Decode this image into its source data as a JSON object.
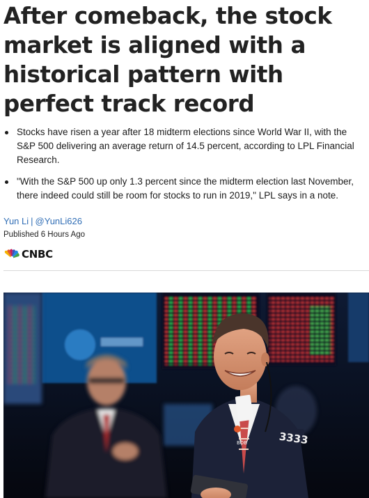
{
  "headline": "After comeback, the stock market is aligned with a historical pattern with perfect track record",
  "bullets": [
    "Stocks have risen a year after 18 midterm elections since World War II, with the S&P 500 delivering an average return of 14.5 percent, according to LPL Financial Research.",
    "\"With the S&P 500 up only 1.3 percent since the midterm election last November, there indeed could still be room for stocks to run in 2019,\" LPL says in a note."
  ],
  "byline": {
    "author": "Yun Li",
    "separator": "|",
    "handle": "@YunLi626"
  },
  "published": "Published 6 Hours Ago",
  "logo": {
    "text": "CNBC",
    "icon": "nbc-peacock-icon"
  },
  "photo": {
    "board_label": "3333",
    "badge_name": "BOB",
    "colors": {
      "board_green": "#2fd05a",
      "board_red": "#e03a3a",
      "jacket": "#1c2238"
    }
  },
  "colors": {
    "link": "#2f6db5",
    "divider": "#d8d8d8",
    "text": "#1a1a1a"
  }
}
